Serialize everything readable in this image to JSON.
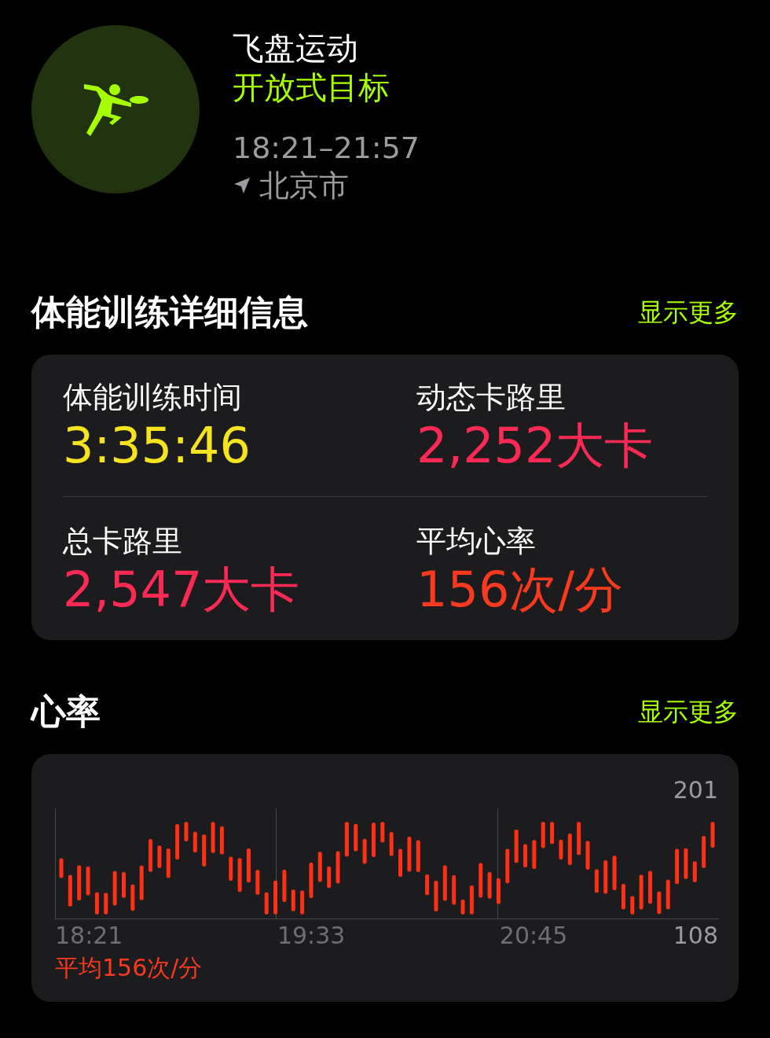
{
  "workout": {
    "name": "飞盘运动",
    "goal": "开放式目标",
    "time_range": "18:21–21:57",
    "location": "北京市"
  },
  "details": {
    "title": "体能训练详细信息",
    "more": "显示更多",
    "metrics": [
      {
        "label": "体能训练时间",
        "value": "3:35:46",
        "color": "#f5e31f"
      },
      {
        "label": "动态卡路里",
        "value": "2,252大卡",
        "color": "#fa2a55"
      },
      {
        "label": "总卡路里",
        "value": "2,547大卡",
        "color": "#fa2a55"
      },
      {
        "label": "平均心率",
        "value": "156次/分",
        "color": "#fa3a1e"
      }
    ]
  },
  "heart_rate": {
    "title": "心率",
    "more": "显示更多",
    "max_label": "201",
    "min_label": "108",
    "time_labels": [
      "18:21",
      "19:33",
      "20:45"
    ],
    "average": "平均156次/分"
  }
}
